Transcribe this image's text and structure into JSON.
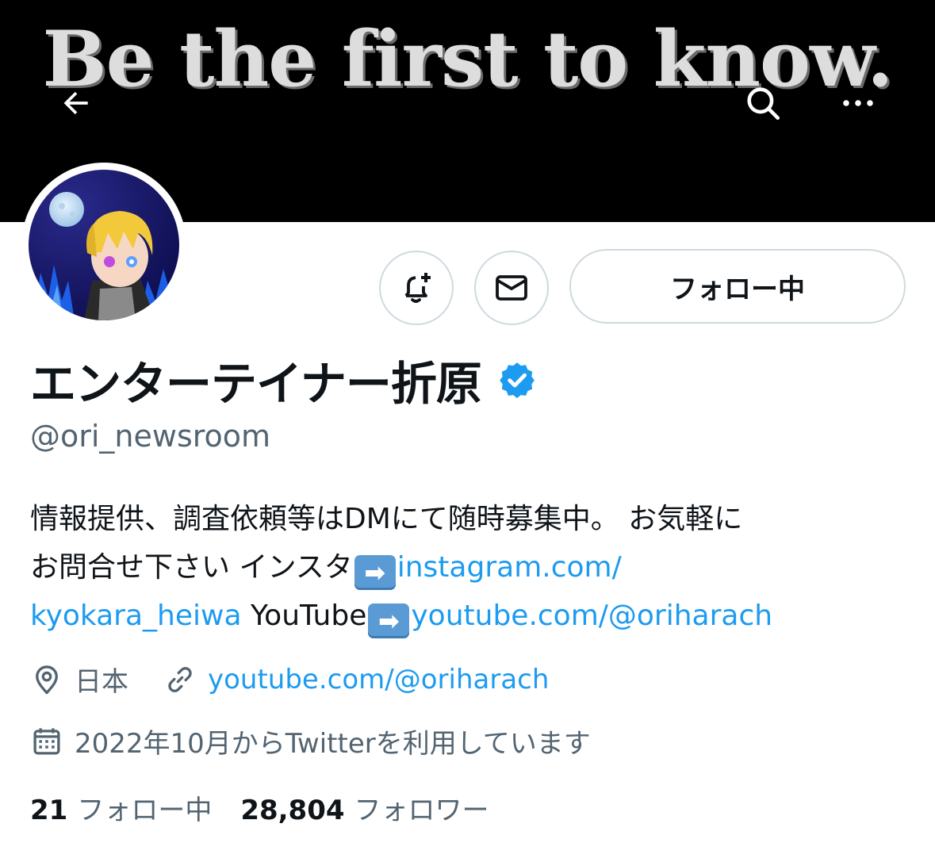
{
  "banner": {
    "text": "Be the first to know."
  },
  "icons": {
    "back": "arrow-left-icon",
    "search": "search-icon",
    "more": "more-dots-icon",
    "notify": "bell-plus-icon",
    "message": "envelope-icon",
    "verified": "verified-badge-icon",
    "location": "location-pin-icon",
    "link": "link-icon",
    "calendar": "calendar-icon"
  },
  "actions": {
    "follow_label": "フォロー中"
  },
  "profile": {
    "name": "エンターテイナー折原",
    "handle": "@ori_newsroom",
    "bio": {
      "line1": "情報提供、調査依頼等はDMにて随時募集中。 お気軽に",
      "line2_text": "お問合せ下さい インスタ",
      "arrow": "➡",
      "line2_link": "instagram.com/",
      "line3_link": "kyokara_heiwa",
      "line3_text": " YouTube",
      "line3_link2": "youtube.com/@oriharach"
    },
    "location": "日本",
    "website": "youtube.com/@oriharach",
    "joined": "2022年10月からTwitterを利用しています"
  },
  "stats": {
    "following_count": "21",
    "following_label": "フォロー中",
    "followers_count": "28,804",
    "followers_label": "フォロワー"
  },
  "colors": {
    "link": "#1d9bf0",
    "secondary_text": "#536471",
    "border": "#cfd9de",
    "verified": "#1d9bf0"
  }
}
